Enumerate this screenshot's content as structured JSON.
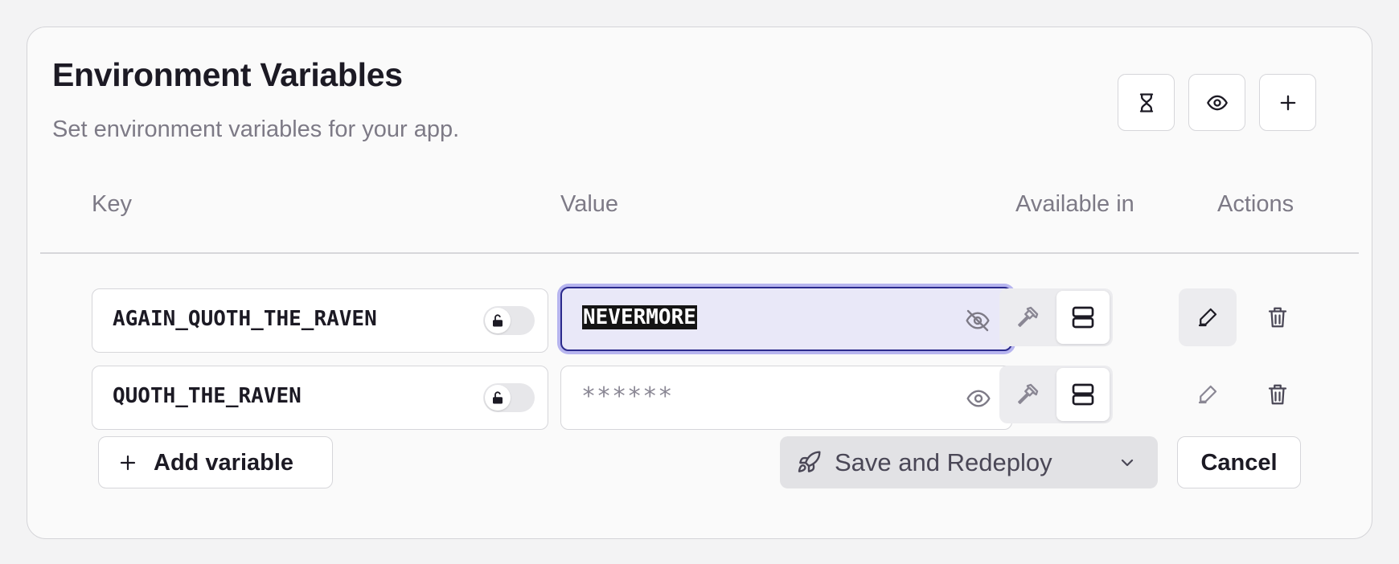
{
  "header": {
    "title": "Environment Variables",
    "subtitle": "Set environment variables for your app.",
    "buttons": [
      {
        "icon": "hourglass-icon"
      },
      {
        "icon": "eye-icon"
      },
      {
        "icon": "plus-icon"
      }
    ]
  },
  "columns": {
    "key": "Key",
    "value": "Value",
    "available_in": "Available in",
    "actions": "Actions"
  },
  "rows": [
    {
      "key": "AGAIN_QUOTH_THE_RAVEN",
      "value": "NEVERMORE",
      "value_visible": true,
      "value_selected": true,
      "locked": false,
      "available": [
        "build",
        "runtime"
      ],
      "active_available": "runtime"
    },
    {
      "key": "QUOTH_THE_RAVEN",
      "value": "******",
      "value_visible": false,
      "value_selected": false,
      "locked": false,
      "available": [
        "build",
        "runtime"
      ],
      "active_available": "runtime"
    }
  ],
  "footer": {
    "add_label": "Add variable",
    "save_label": "Save and Redeploy",
    "cancel_label": "Cancel"
  },
  "colors": {
    "accent": "#2b2a8c",
    "focus_ring": "#b7b5ef",
    "focus_bg": "#e9e8f8",
    "muted_text": "#7d7a86"
  }
}
